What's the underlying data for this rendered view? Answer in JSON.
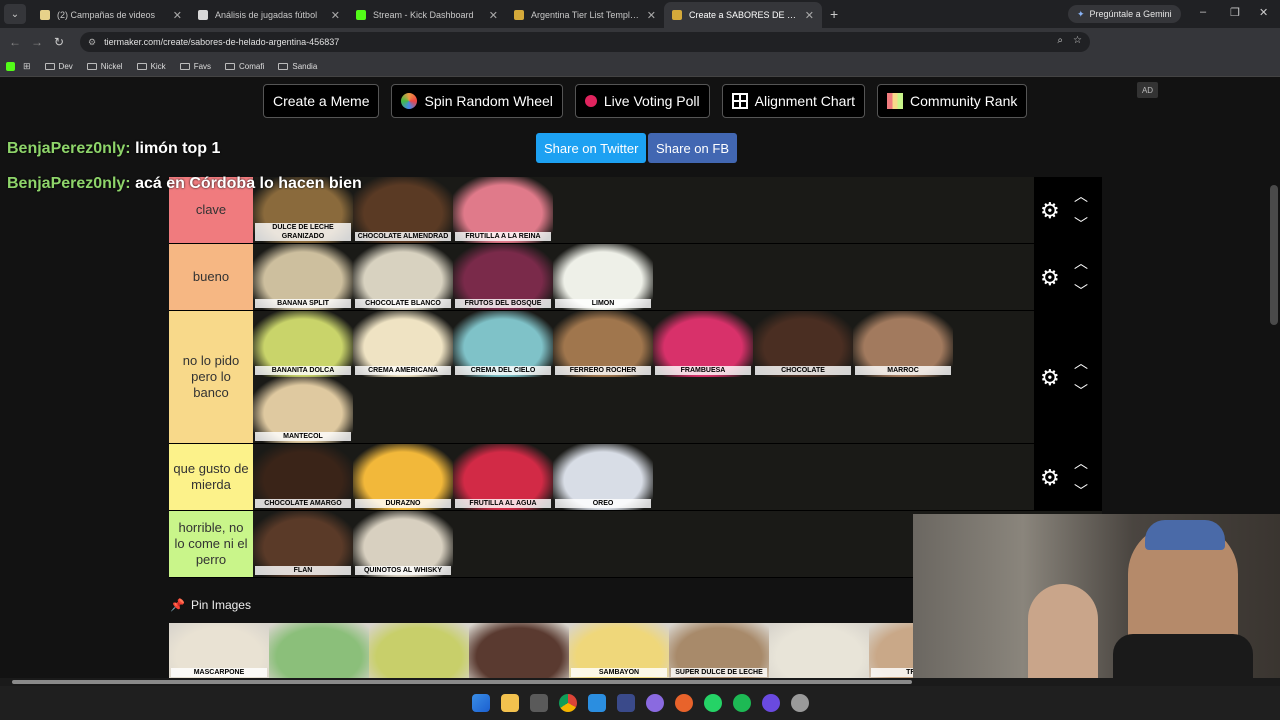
{
  "browser": {
    "tabs": [
      {
        "title": "(2) Campañas de videos",
        "color": "#e7d28a"
      },
      {
        "title": "Análisis de jugadas fútbol",
        "color": "#d8d8d8"
      },
      {
        "title": "Stream - Kick Dashboard",
        "color": "#53fc18"
      },
      {
        "title": "Argentina Tier List Templates -",
        "color": "#d4a93a"
      },
      {
        "title": "Create a SABORES DE HELADO",
        "color": "#d4a93a"
      }
    ],
    "gemini_button": "Pregúntale a Gemini",
    "url": "tiermaker.com/create/sabores-de-helado-argentina-456837",
    "bookmarks": [
      "Dev",
      "Nickel",
      "Kick",
      "Favs",
      "Comafi",
      "Sandia"
    ]
  },
  "toolbar": {
    "create_meme": "Create a Meme",
    "spin_wheel": "Spin Random Wheel",
    "live_poll": "Live Voting Poll",
    "alignment": "Alignment Chart",
    "community": "Community Rank",
    "ad": "AD"
  },
  "share": {
    "twitter": "Share on Twitter",
    "fb": "Share on FB"
  },
  "chat": [
    {
      "user": "BenjaPerez0nly:",
      "message": "limón top 1"
    },
    {
      "user": "BenjaPerez0nly:",
      "message": "acá en Córdoba lo hacen bien"
    }
  ],
  "tiers": [
    {
      "label": "clave",
      "color": "#f07b7e",
      "items": [
        {
          "name": "DULCE DE LECHE GRANIZADO",
          "color": "#8a6a3c"
        },
        {
          "name": "CHOCOLATE ALMENDRAD",
          "color": "#5a3a24"
        },
        {
          "name": "FRUTILLA A LA REINA",
          "color": "#e07a8a"
        }
      ]
    },
    {
      "label": "bueno",
      "color": "#f6b783",
      "items": [
        {
          "name": "BANANA SPLIT",
          "color": "#cdbf9e"
        },
        {
          "name": "CHOCOLATE BLANCO",
          "color": "#d8d2c0"
        },
        {
          "name": "FRUTOS DEL BOSQUE",
          "color": "#7a2a4a"
        },
        {
          "name": "LIMON",
          "color": "#eef0e8"
        }
      ]
    },
    {
      "label": "no lo pido pero lo banco",
      "color": "#f8d98a",
      "items": [
        {
          "name": "BANANITA DOLCA",
          "color": "#c9d46a"
        },
        {
          "name": "CREMA AMERICANA",
          "color": "#efe3c3"
        },
        {
          "name": "CREMA DEL CIELO",
          "color": "#7fc2c8"
        },
        {
          "name": "FERRERO ROCHER",
          "color": "#a0764d"
        },
        {
          "name": "FRAMBUESA",
          "color": "#d8316a"
        },
        {
          "name": "CHOCOLATE",
          "color": "#4a2e22"
        },
        {
          "name": "MARROC",
          "color": "#a27a5e"
        },
        {
          "name": "MANTECOL",
          "color": "#dfc9a0"
        }
      ]
    },
    {
      "label": "que gusto de mierda",
      "color": "#fcf28a",
      "items": [
        {
          "name": "CHOCOLATE AMARGO",
          "color": "#3a2418"
        },
        {
          "name": "DURAZNO",
          "color": "#f2b83a"
        },
        {
          "name": "FRUTILLA AL AGUA",
          "color": "#d22a46"
        },
        {
          "name": "OREO",
          "color": "#d8dde6"
        }
      ]
    },
    {
      "label": "horrible, no lo come ni el perro",
      "color": "#c9f58a",
      "items": [
        {
          "name": "FLAN",
          "color": "#5a3a28"
        },
        {
          "name": "QUINOTOS AL WHISKY",
          "color": "#d8d0c0"
        }
      ]
    }
  ],
  "pin_images": {
    "label": "Pin Images"
  },
  "pool": [
    {
      "name": "MASCARPONE",
      "color": "#e9e2d3"
    },
    {
      "name": "",
      "color": "#8bbf7a"
    },
    {
      "name": "",
      "color": "#c8cf6a"
    },
    {
      "name": "",
      "color": "#5a3a30"
    },
    {
      "name": "SAMBAYON",
      "color": "#efd77a"
    },
    {
      "name": "SUPER DULCE DE LECHE",
      "color": "#a88a6a"
    },
    {
      "name": "",
      "color": "#e8e4d8"
    },
    {
      "name": "TRAMO",
      "color": "#c9a888"
    }
  ]
}
